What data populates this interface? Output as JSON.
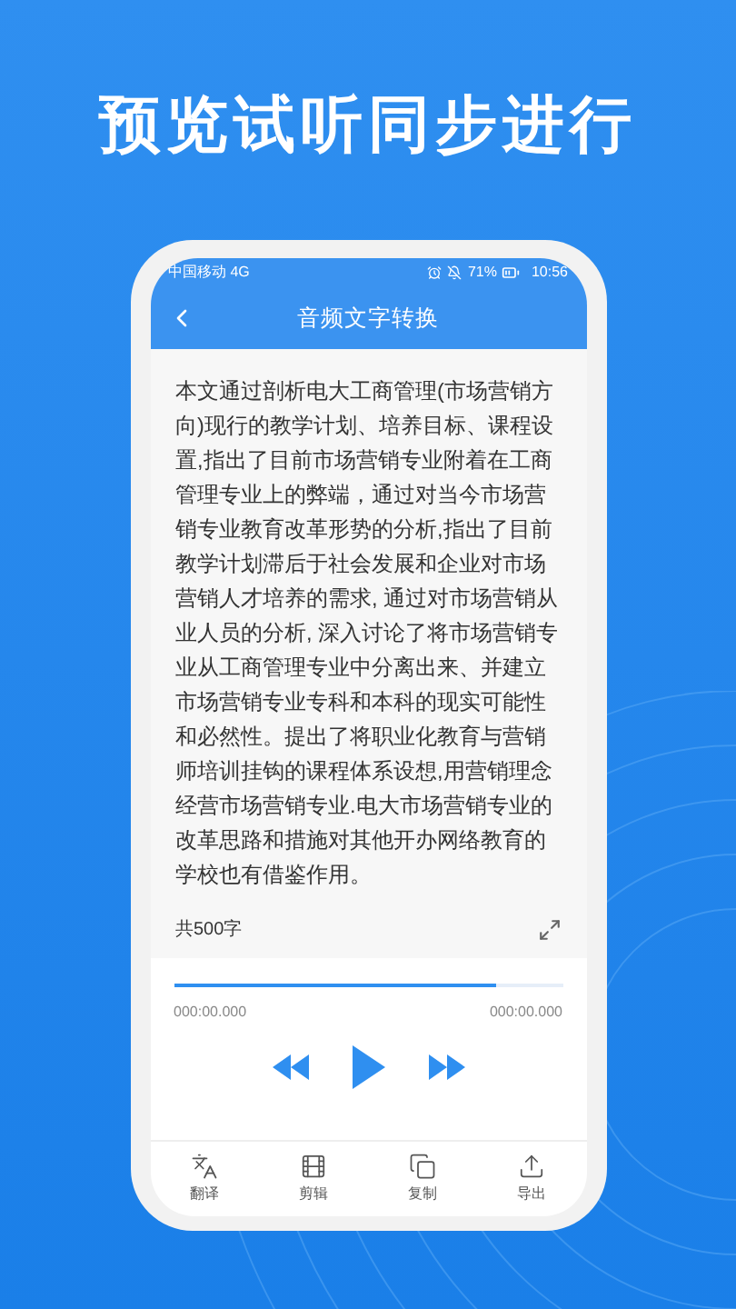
{
  "headline": "预览试听同步进行",
  "status_bar": {
    "carrier": "中国移动 4G",
    "battery": "71%",
    "time": "10:56"
  },
  "nav": {
    "title": "音频文字转换"
  },
  "content": {
    "text": "本文通过剖析电大工商管理(市场营销方向)现行的教学计划、培养目标、课程设置,指出了目前市场营销专业附着在工商管理专业上的弊端，通过对当今市场营销专业教育改革形势的分析,指出了目前教学计划滞后于社会发展和企业对市场营销人才培养的需求, 通过对市场营销从业人员的分析, 深入讨论了将市场营销专业从工商管理专业中分离出来、并建立市场营销专业专科和本科的现实可能性和必然性。提出了将职业化教育与营销师培训挂钩的课程体系设想,用营销理念经营市场营销专业.电大市场营销专业的改革思路和措施对其他开办网络教育的学校也有借鉴作用。",
    "count": "共500字"
  },
  "player": {
    "level": 0.83,
    "current": "000:00.000",
    "total": "000:00.000"
  },
  "toolbar": [
    {
      "kind": "translate",
      "label": "翻译"
    },
    {
      "kind": "edit",
      "label": "剪辑"
    },
    {
      "kind": "copy",
      "label": "复制"
    },
    {
      "kind": "export",
      "label": "导出"
    }
  ]
}
